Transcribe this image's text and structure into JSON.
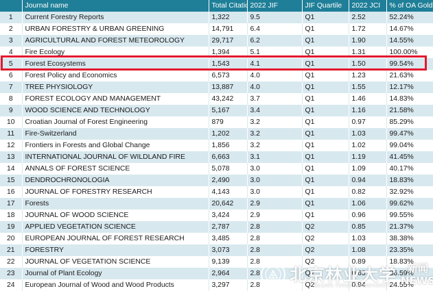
{
  "table": {
    "headers": {
      "rank": "",
      "name": "Journal name",
      "citations": "Total Citations",
      "jif": "2022 JIF",
      "quartile": "JIF Quartile",
      "jci": "2022 JCI",
      "oa": "% of OA Gold"
    },
    "rows": [
      {
        "rank": "1",
        "name": "Current Forestry Reports",
        "citations": "1,322",
        "jif": "9.5",
        "quartile": "Q1",
        "jci": "2.52",
        "oa": "52.24%"
      },
      {
        "rank": "2",
        "name": "URBAN FORESTRY & URBAN GREENING",
        "citations": "14,791",
        "jif": "6.4",
        "quartile": "Q1",
        "jci": "1.72",
        "oa": "14.67%"
      },
      {
        "rank": "3",
        "name": "AGRICULTURAL AND FOREST METEOROLOGY",
        "citations": "29,717",
        "jif": "6.2",
        "quartile": "Q1",
        "jci": "1.90",
        "oa": "14.55%"
      },
      {
        "rank": "4",
        "name": "Fire Ecology",
        "citations": "1,394",
        "jif": "5.1",
        "quartile": "Q1",
        "jci": "1.31",
        "oa": "100.00%"
      },
      {
        "rank": "5",
        "name": "Forest Ecosystems",
        "citations": "1,543",
        "jif": "4.1",
        "quartile": "Q1",
        "jci": "1.50",
        "oa": "99.54%"
      },
      {
        "rank": "6",
        "name": "Forest Policy and Economics",
        "citations": "6,573",
        "jif": "4.0",
        "quartile": "Q1",
        "jci": "1.23",
        "oa": "21.63%"
      },
      {
        "rank": "7",
        "name": "TREE PHYSIOLOGY",
        "citations": "13,887",
        "jif": "4.0",
        "quartile": "Q1",
        "jci": "1.55",
        "oa": "12.17%"
      },
      {
        "rank": "8",
        "name": "FOREST ECOLOGY AND MANAGEMENT",
        "citations": "43,242",
        "jif": "3.7",
        "quartile": "Q1",
        "jci": "1.46",
        "oa": "14.83%"
      },
      {
        "rank": "9",
        "name": "WOOD SCIENCE AND TECHNOLOGY",
        "citations": "5,167",
        "jif": "3.4",
        "quartile": "Q1",
        "jci": "1.16",
        "oa": "21.58%"
      },
      {
        "rank": "10",
        "name": "Croatian Journal of Forest Engineering",
        "citations": "879",
        "jif": "3.2",
        "quartile": "Q1",
        "jci": "0.97",
        "oa": "85.29%"
      },
      {
        "rank": "11",
        "name": "Fire-Switzerland",
        "citations": "1,202",
        "jif": "3.2",
        "quartile": "Q1",
        "jci": "1.03",
        "oa": "99.47%"
      },
      {
        "rank": "12",
        "name": "Frontiers in Forests and Global Change",
        "citations": "1,856",
        "jif": "3.2",
        "quartile": "Q1",
        "jci": "1.02",
        "oa": "99.04%"
      },
      {
        "rank": "13",
        "name": "INTERNATIONAL JOURNAL OF WILDLAND FIRE",
        "citations": "6,663",
        "jif": "3.1",
        "quartile": "Q1",
        "jci": "1.19",
        "oa": "41.45%"
      },
      {
        "rank": "14",
        "name": "ANNALS OF FOREST SCIENCE",
        "citations": "5,078",
        "jif": "3.0",
        "quartile": "Q1",
        "jci": "1.09",
        "oa": "40.17%"
      },
      {
        "rank": "15",
        "name": "DENDROCHRONOLOGIA",
        "citations": "2,490",
        "jif": "3.0",
        "quartile": "Q1",
        "jci": "0.94",
        "oa": "18.83%"
      },
      {
        "rank": "16",
        "name": "JOURNAL OF FORESTRY RESEARCH",
        "citations": "4,143",
        "jif": "3.0",
        "quartile": "Q1",
        "jci": "0.82",
        "oa": "32.92%"
      },
      {
        "rank": "17",
        "name": "Forests",
        "citations": "20,642",
        "jif": "2.9",
        "quartile": "Q1",
        "jci": "1.06",
        "oa": "99.62%"
      },
      {
        "rank": "18",
        "name": "JOURNAL OF WOOD SCIENCE",
        "citations": "3,424",
        "jif": "2.9",
        "quartile": "Q1",
        "jci": "0.96",
        "oa": "99.55%"
      },
      {
        "rank": "19",
        "name": "APPLIED VEGETATION SCIENCE",
        "citations": "2,787",
        "jif": "2.8",
        "quartile": "Q2",
        "jci": "0.85",
        "oa": "21.37%"
      },
      {
        "rank": "20",
        "name": "EUROPEAN JOURNAL OF FOREST RESEARCH",
        "citations": "3,485",
        "jif": "2.8",
        "quartile": "Q2",
        "jci": "1.03",
        "oa": "38.38%"
      },
      {
        "rank": "21",
        "name": "FORESTRY",
        "citations": "3,073",
        "jif": "2.8",
        "quartile": "Q2",
        "jci": "1.08",
        "oa": "23.35%"
      },
      {
        "rank": "22",
        "name": "JOURNAL OF VEGETATION SCIENCE",
        "citations": "9,139",
        "jif": "2.8",
        "quartile": "Q2",
        "jci": "0.89",
        "oa": "18.83%"
      },
      {
        "rank": "23",
        "name": "Journal of Plant Ecology",
        "citations": "2,964",
        "jif": "2.8",
        "quartile": "Q2",
        "jci": "0.65",
        "oa": "36.59%"
      },
      {
        "rank": "24",
        "name": "European Journal of Wood and Wood Products",
        "citations": "3,297",
        "jif": "2.8",
        "quartile": "Q2",
        "jci": "0.94",
        "oa": "24.55%"
      }
    ]
  },
  "highlight": {
    "row_rank": "5",
    "color": "#e3182d"
  },
  "watermark": {
    "name_cn": "北京林业大学",
    "name_en": "BEIJING FORESTRY UNIVERSITY",
    "news_cn": "新闻",
    "news_en": "NEWS",
    "seal_icon": "university-seal-icon"
  },
  "colors": {
    "header_bg": "#1f7f98",
    "stripe": "#d8e8ef",
    "highlight": "#e3182d"
  }
}
